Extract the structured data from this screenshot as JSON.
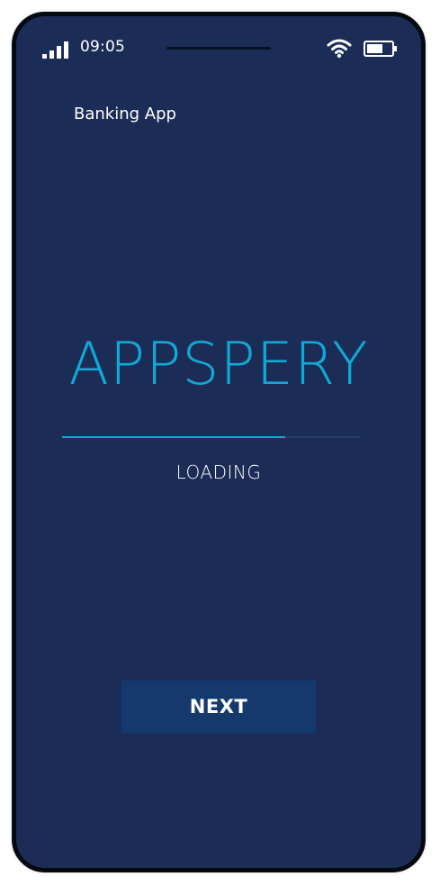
{
  "status_bar": {
    "time": "09:05",
    "signal_icon": "signal-bars-icon",
    "wifi_icon": "wifi-icon",
    "battery_icon": "battery-icon"
  },
  "app_label": "Banking App",
  "brand": "APPSPERY",
  "loading": {
    "label": "LOADING",
    "progress": 0.75
  },
  "next_button": {
    "label": "NEXT"
  },
  "colors": {
    "background": "#1b2d57",
    "accent": "#11a9d7",
    "button": "#16396d"
  }
}
